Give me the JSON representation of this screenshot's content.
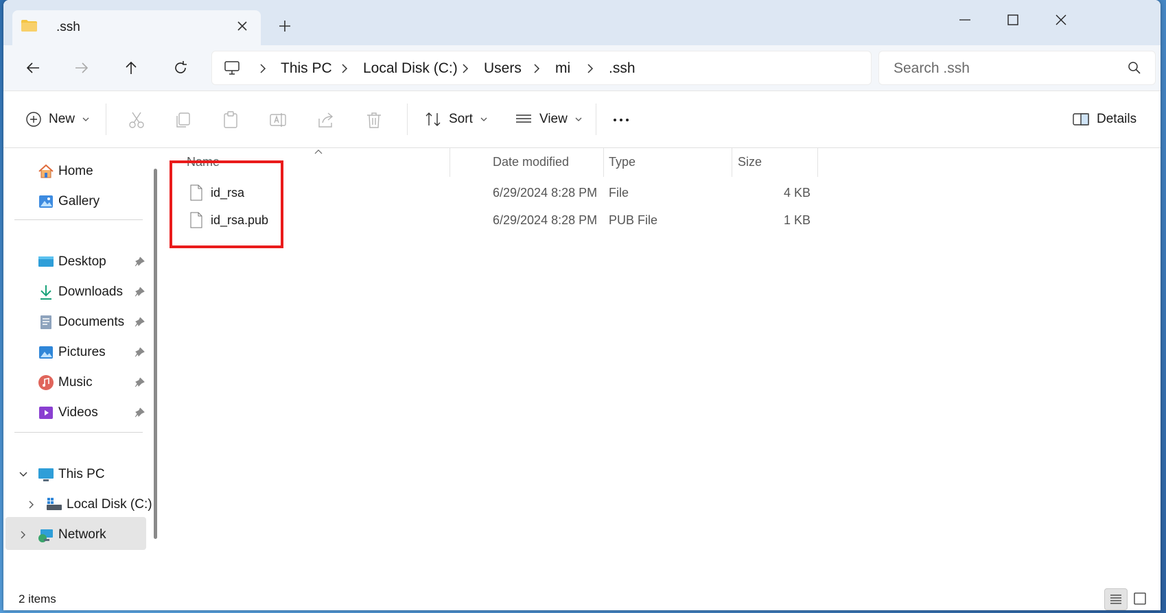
{
  "window": {
    "tab_title": ".ssh",
    "controls": {
      "minimize": "minimize-icon",
      "maximize": "maximize-icon",
      "close": "close-icon"
    }
  },
  "address": {
    "crumbs": [
      "This PC",
      "Local Disk (C:)",
      "Users",
      "mi",
      ".ssh"
    ]
  },
  "search": {
    "placeholder": "Search .ssh"
  },
  "toolbar": {
    "new_label": "New",
    "sort_label": "Sort",
    "view_label": "View",
    "details_label": "Details"
  },
  "sidebar": {
    "quick": [
      {
        "label": "Home",
        "icon": "home-icon"
      },
      {
        "label": "Gallery",
        "icon": "gallery-icon"
      }
    ],
    "pinned": [
      {
        "label": "Desktop",
        "icon": "desktop-icon"
      },
      {
        "label": "Downloads",
        "icon": "downloads-icon"
      },
      {
        "label": "Documents",
        "icon": "documents-icon"
      },
      {
        "label": "Pictures",
        "icon": "pictures-icon"
      },
      {
        "label": "Music",
        "icon": "music-icon"
      },
      {
        "label": "Videos",
        "icon": "videos-icon"
      }
    ],
    "tree": {
      "this_pc": "This PC",
      "local_disk": "Local Disk (C:)",
      "network": "Network"
    }
  },
  "columns": {
    "name": "Name",
    "date": "Date modified",
    "type": "Type",
    "size": "Size"
  },
  "files": [
    {
      "name": "id_rsa",
      "date": "6/29/2024 8:28 PM",
      "type": "File",
      "size": "4 KB"
    },
    {
      "name": "id_rsa.pub",
      "date": "6/29/2024 8:28 PM",
      "type": "PUB File",
      "size": "1 KB"
    }
  ],
  "status": {
    "count": "2 items"
  },
  "colors": {
    "highlight": "#ea1b1b",
    "accent": "#0067c0",
    "folder": "#f4c542"
  }
}
